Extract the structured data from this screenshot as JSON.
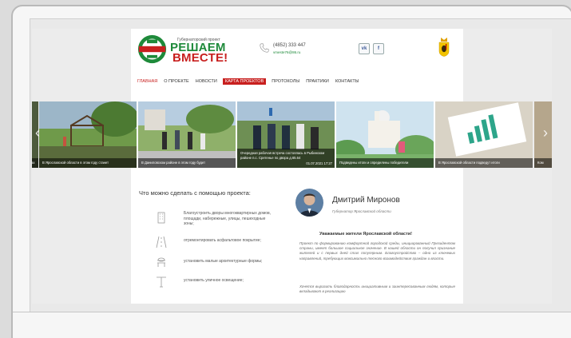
{
  "header": {
    "project_label": "Губернаторский проект",
    "title_line1": "РЕШАЕМ",
    "title_line2": "ВМЕСТЕ!",
    "logo_text": "РЕШАЕМ ВМЕСТЕ",
    "phone": "(4852) 333 447",
    "email": "vmeste76@86.ru",
    "vk_label": "vk",
    "fb_label": "f",
    "coat_of_arms_icon": "yaroslavl-coat-of-arms"
  },
  "nav": {
    "items": [
      {
        "label": "ГЛАВНАЯ"
      },
      {
        "label": "О ПРОЕКТЕ"
      },
      {
        "label": "НОВОСТИ"
      },
      {
        "label": "КАРТА ПРОЕКТОВ"
      },
      {
        "label": "ПРОТОКОЛЫ"
      },
      {
        "label": "ПРАКТИКИ"
      },
      {
        "label": "КОНТАКТЫ"
      }
    ]
  },
  "slider": {
    "slides": [
      {
        "caption": "ах"
      },
      {
        "caption": "В Ярославской области в этом году станет"
      },
      {
        "caption": "В Даниловском районе в этом году будет"
      },
      {
        "caption": "Очередная рабочая встреча состоялась в Рыбинском районе п.с. Сретенье по двора д.65.64",
        "date": "01.07.2021 17:27"
      },
      {
        "caption": "Подведены итоги и определены победители"
      },
      {
        "caption": "В Ярославской области подведут итоги"
      },
      {
        "caption": "Ком"
      }
    ]
  },
  "features": {
    "heading": "Что можно сделать с помощью проекта:",
    "items": [
      {
        "text": "Благоустроить дворы многоквартирных домов, площади, набережные, улицы, пешеходные зоны;",
        "icon": "building-icon"
      },
      {
        "text": "отремонтировать асфальтовое покрытие;",
        "icon": "road-icon"
      },
      {
        "text": "установить малые архитектурные формы;",
        "icon": "bench-icon"
      },
      {
        "text": "установить уличное освещение;",
        "icon": "street-lamp-icon"
      }
    ]
  },
  "governor": {
    "name": "Дмитрий Миронов",
    "role": "Губернатор Ярославской области",
    "greeting": "Уважаемые жители Ярославской области!",
    "paragraph1": "Проект по формированию комфортной городской среды, инициированный Президентом страны, имеет большое социальное значение. В нашей области он получил признание жителей и с первых дней стал популярным. Благоустройство – одно из ключевых направлений, требующих максимально тесного взаимодействия граждан и власти.",
    "paragraph2": "Хочется выразить благодарность инициативным и заинтересованным людям, которые вкладывают в реализацию"
  },
  "colors": {
    "brand_green": "#1e8a3a",
    "brand_red": "#c8201f",
    "frame_bg": "#f6f6f6",
    "screen_bg": "#ececec"
  }
}
